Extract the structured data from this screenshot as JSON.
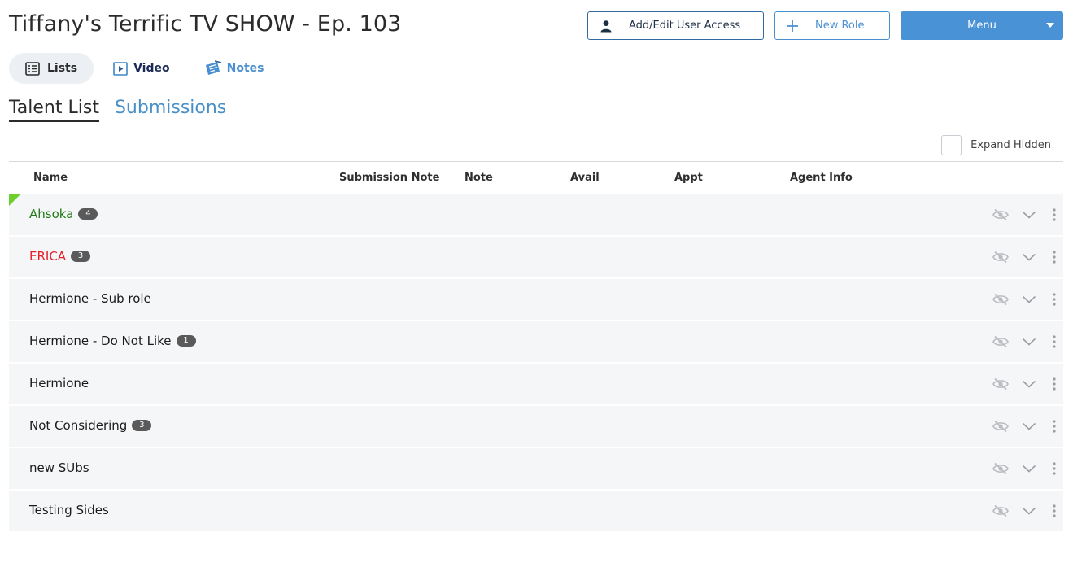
{
  "header": {
    "title": "Tiffany's Terrific TV SHOW - Ep. 103",
    "add_user_access": "Add/Edit User Access",
    "new_role": "New Role",
    "menu": "Menu"
  },
  "view_tabs": {
    "lists": "Lists",
    "video": "Video",
    "notes": "Notes"
  },
  "list_tabs": {
    "talent_list": "Talent List",
    "submissions": "Submissions"
  },
  "expand_hidden": "Expand Hidden",
  "table": {
    "columns": [
      "Name",
      "Submission Note",
      "Note",
      "Avail",
      "Appt",
      "Agent Info"
    ],
    "rows": [
      {
        "name": "Ahsoka",
        "badge": "4"
      },
      {
        "name": "ERICA",
        "badge": "3"
      },
      {
        "name": "Hermione - Sub role",
        "badge": ""
      },
      {
        "name": "Hermione - Do Not Like",
        "badge": "1"
      },
      {
        "name": "Hermione",
        "badge": ""
      },
      {
        "name": "Not Considering",
        "badge": "3"
      },
      {
        "name": "new SUbs",
        "badge": ""
      },
      {
        "name": "Testing Sides",
        "badge": ""
      }
    ]
  },
  "colors": {
    "accent": "#4a92d6",
    "green_name": "#237a17",
    "red_name": "#e5202a",
    "corner_flag": "#6ccf2c"
  },
  "icons": {
    "add_user": "user-icon",
    "new_role": "plus-icon",
    "menu": "caret-down-icon",
    "lists": "list-icon",
    "video": "video-play-icon",
    "notes": "notes-icon",
    "row_hide": "eye-slash-icon",
    "row_expand": "chevron-down-icon",
    "row_more": "kebab-icon"
  }
}
